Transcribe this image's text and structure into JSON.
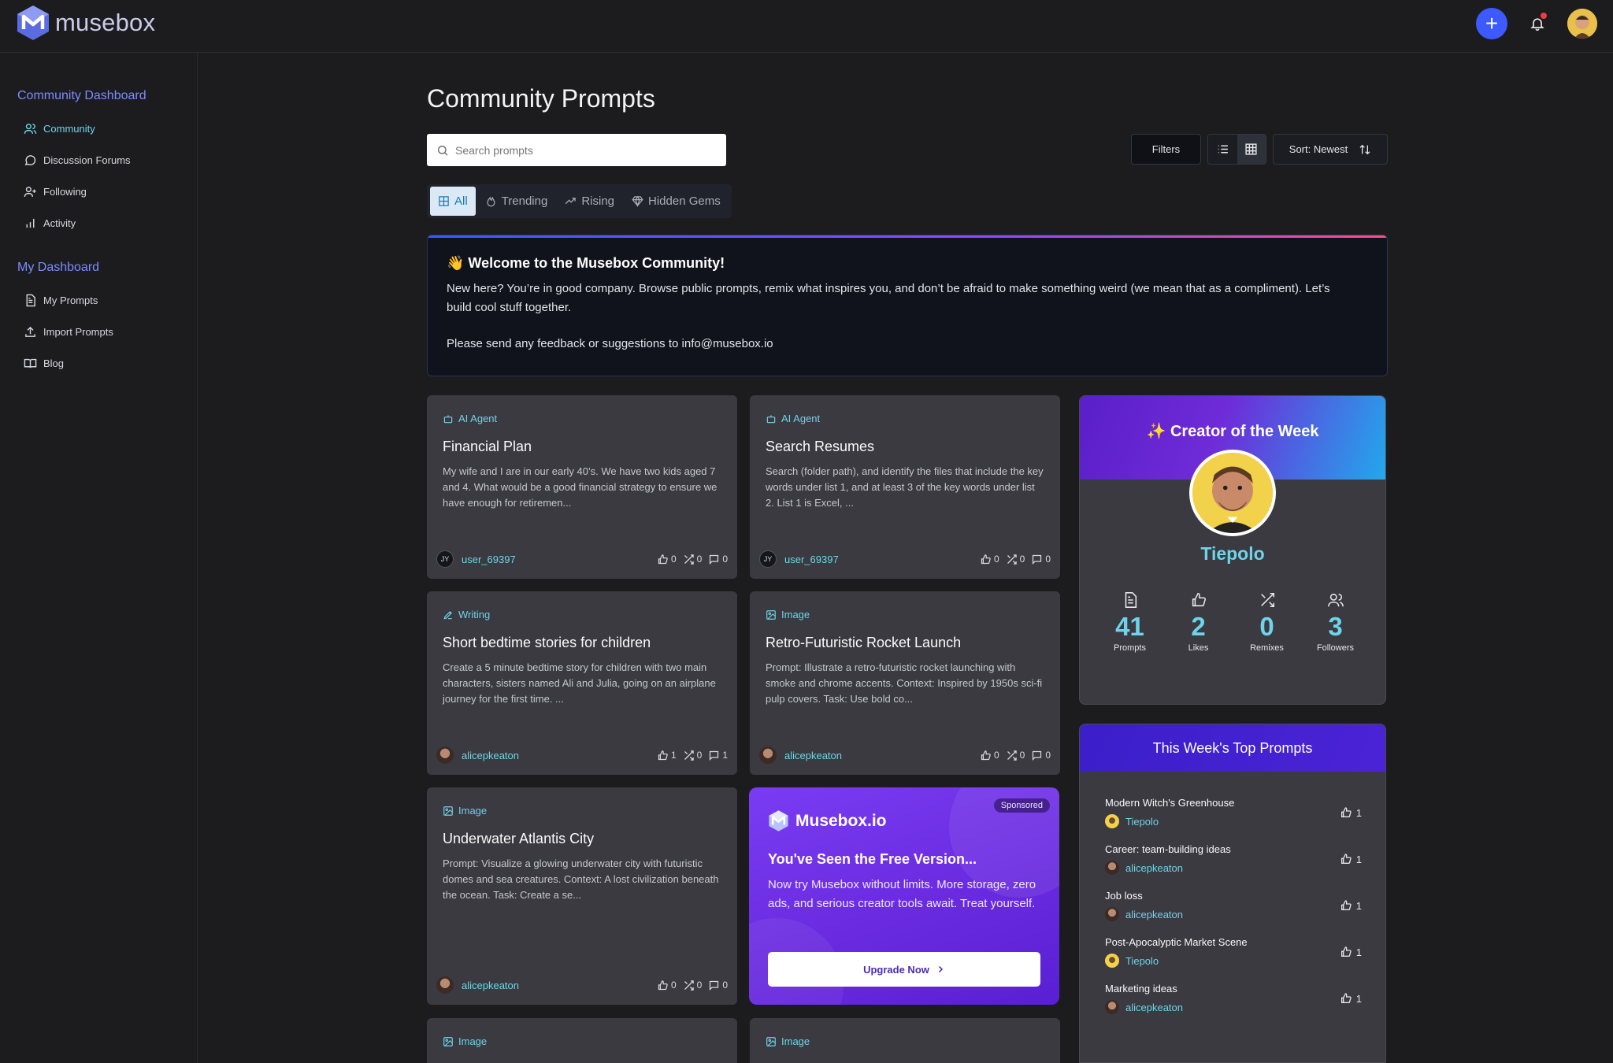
{
  "app": {
    "name": "musebox"
  },
  "sidebar": {
    "section1": "Community Dashboard",
    "items1": [
      {
        "label": "Community",
        "icon": "users-icon",
        "active": true
      },
      {
        "label": "Discussion Forums",
        "icon": "chat-bubble-icon"
      },
      {
        "label": "Following",
        "icon": "user-plus-icon"
      },
      {
        "label": "Activity",
        "icon": "bar-chart-icon"
      }
    ],
    "section2": "My Dashboard",
    "items2": [
      {
        "label": "My Prompts",
        "icon": "document-icon"
      },
      {
        "label": "Import Prompts",
        "icon": "upload-icon"
      },
      {
        "label": "Blog",
        "icon": "book-icon"
      }
    ]
  },
  "main": {
    "title": "Community Prompts",
    "search_placeholder": "Search prompts",
    "filters_label": "Filters",
    "sort_label": "Sort: Newest",
    "tabs": [
      {
        "label": "All",
        "active": true
      },
      {
        "label": "Trending"
      },
      {
        "label": "Rising"
      },
      {
        "label": "Hidden Gems"
      }
    ]
  },
  "welcome": {
    "title": "👋 Welcome to the Musebox Community!",
    "body": "New here? You’re in good company. Browse public prompts, remix what inspires you, and don’t be afraid to make something weird (we mean that as a compliment). Let’s build cool stuff together.",
    "feedback": "Please send any feedback or suggestions to info@musebox.io"
  },
  "cards": [
    {
      "category": "AI Agent",
      "title": "Financial Plan",
      "desc": "My wife and I are in our early 40’s. We have two kids aged 7 and 4. What would be a good financial strategy to ensure we have enough for retiremen...",
      "user": "user_69397",
      "initials": "JY",
      "likes": "0",
      "remixes": "0",
      "comments": "0"
    },
    {
      "category": "AI Agent",
      "title": "Search Resumes",
      "desc": "Search (folder path), and identify the files that include the key words under list 1, and at least 3 of the key words under list 2. List 1 is Excel, ...",
      "user": "user_69397",
      "initials": "JY",
      "likes": "0",
      "remixes": "0",
      "comments": "0"
    },
    {
      "category": "Writing",
      "title": "Short bedtime stories for children",
      "desc": "Create a 5 minute bedtime story for children with two main characters, sisters named Ali and Julia, going on an airplane journey for the first time. ...",
      "user": "alicepkeaton",
      "initials": "",
      "likes": "1",
      "remixes": "0",
      "comments": "1"
    },
    {
      "category": "Image",
      "title": "Retro-Futuristic Rocket Launch",
      "desc": "Prompt: Illustrate a retro-futuristic rocket launching with smoke and chrome accents. Context: Inspired by 1950s sci-fi pulp covers. Task: Use bold co...",
      "user": "alicepkeaton",
      "initials": "",
      "likes": "0",
      "remixes": "0",
      "comments": "0"
    },
    {
      "category": "Image",
      "title": "Underwater Atlantis City",
      "desc": "Prompt: Visualize a glowing underwater city with futuristic domes and sea creatures. Context: A lost civilization beneath the ocean. Task: Create a se...",
      "user": "alicepkeaton",
      "initials": "",
      "likes": "0",
      "remixes": "0",
      "comments": "0"
    }
  ],
  "more_cards": [
    {
      "category": "Image"
    },
    {
      "category": "Image"
    }
  ],
  "promo": {
    "badge": "Sponsored",
    "brand": "Musebox.io",
    "headline": "You've Seen the Free Version...",
    "body": "Now try Musebox without limits. More storage, zero ads, and serious creator tools await. Treat yourself.",
    "button": "Upgrade Now"
  },
  "creator": {
    "heading": "✨ Creator of the Week",
    "name": "Tiepolo",
    "stats": [
      {
        "value": "41",
        "label": "Prompts",
        "icon": "document-icon"
      },
      {
        "value": "2",
        "label": "Likes",
        "icon": "thumbs-up-icon"
      },
      {
        "value": "0",
        "label": "Remixes",
        "icon": "shuffle-icon"
      },
      {
        "value": "3",
        "label": "Followers",
        "icon": "users-icon"
      }
    ]
  },
  "top_prompts": {
    "heading": "This Week's Top Prompts",
    "items": [
      {
        "title": "Modern Witch's Greenhouse",
        "author": "Tiepolo",
        "likes": "1"
      },
      {
        "title": "Career: team-building ideas",
        "author": "alicepkeaton",
        "likes": "1"
      },
      {
        "title": "Job loss",
        "author": "alicepkeaton",
        "likes": "1"
      },
      {
        "title": "Post-Apocalyptic Market Scene",
        "author": "Tiepolo",
        "likes": "1"
      },
      {
        "title": "Marketing ideas",
        "author": "alicepkeaton",
        "likes": "1"
      }
    ]
  },
  "colors": {
    "accent": "#6fd3ea",
    "primary": "#3d5afe",
    "promo": "#6a2be0",
    "sidebar_heading": "#7b8cff"
  }
}
